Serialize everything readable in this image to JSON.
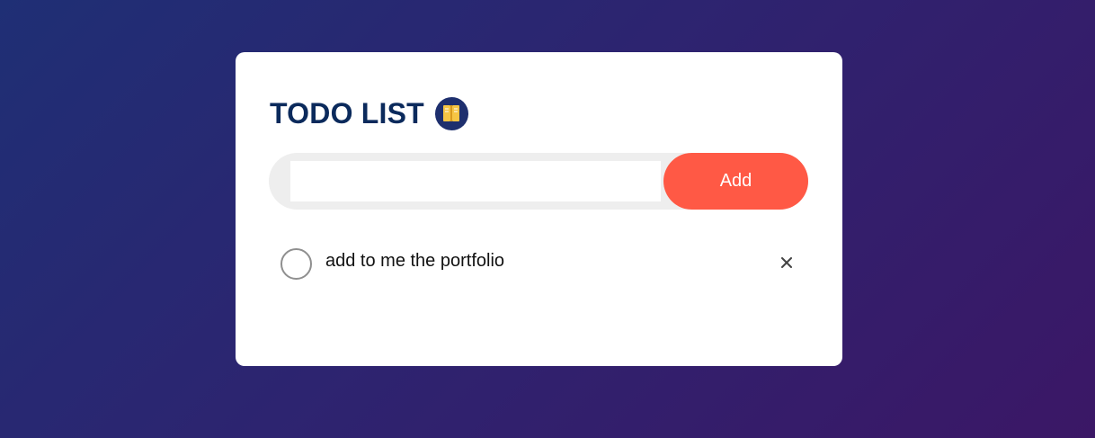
{
  "app": {
    "title": "TODO LIST",
    "title_icon": "notebook-icon"
  },
  "colors": {
    "accent": "#ff5945",
    "title": "#0b2a5c",
    "background_start": "#1f2f75",
    "background_end": "#3b1766"
  },
  "input": {
    "value": "",
    "placeholder": ""
  },
  "add_button": {
    "label": "Add"
  },
  "tasks": [
    {
      "text": "add to me the portfolio",
      "checked": false,
      "delete_icon": "close-icon"
    }
  ]
}
